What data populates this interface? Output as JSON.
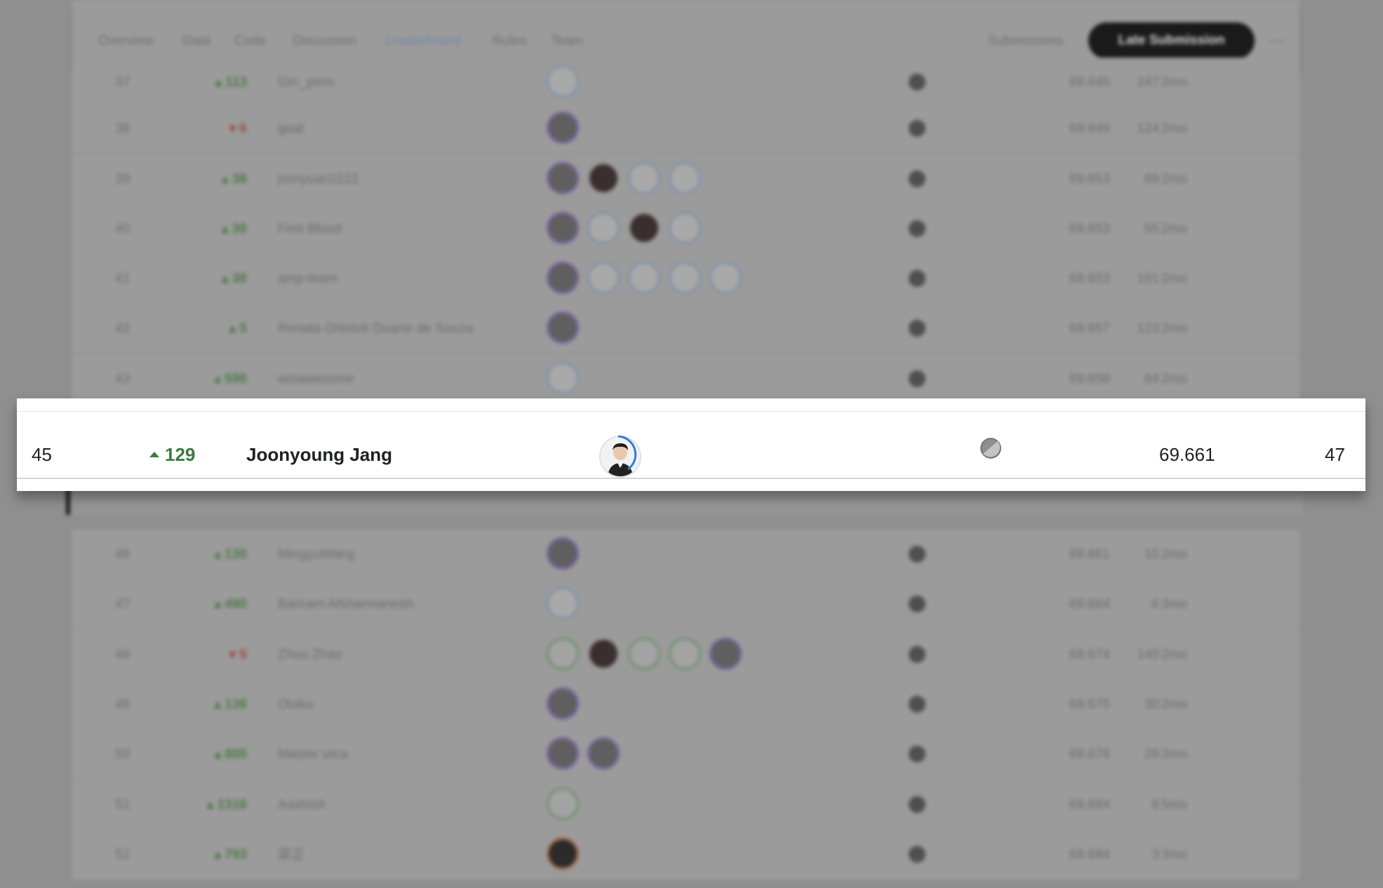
{
  "tabs": [
    {
      "label": "Overview",
      "active": false
    },
    {
      "label": "Data",
      "active": false
    },
    {
      "label": "Code",
      "active": false
    },
    {
      "label": "Discussion",
      "active": false
    },
    {
      "label": "Leaderboard",
      "active": true
    },
    {
      "label": "Rules",
      "active": false
    },
    {
      "label": "Team",
      "active": false
    }
  ],
  "submissions_label": "Submissions",
  "late_submission_label": "Late Submission",
  "more_label": "···",
  "rows": [
    {
      "rank": "37",
      "delta": "113",
      "dir": "up",
      "team": "Gin_yiem",
      "members": [
        "light"
      ],
      "score": "69.645",
      "entries": "247",
      "last": "2mo"
    },
    {
      "rank": "38",
      "delta": "6",
      "dir": "down",
      "team": "goat",
      "members": [
        "purple"
      ],
      "score": "69.649",
      "entries": "124",
      "last": "2mo"
    },
    {
      "rank": "39",
      "delta": "38",
      "dir": "up",
      "team": "jixinyuan1122",
      "members": [
        "purple",
        "dark",
        "light",
        "light"
      ],
      "score": "69.653",
      "entries": "89",
      "last": "2mo"
    },
    {
      "rank": "40",
      "delta": "38",
      "dir": "up",
      "team": "First Blood",
      "members": [
        "purple",
        "light",
        "dark",
        "light"
      ],
      "score": "69.653",
      "entries": "55",
      "last": "2mo"
    },
    {
      "rank": "41",
      "delta": "38",
      "dir": "up",
      "team": "amp-team",
      "members": [
        "purple",
        "light",
        "light",
        "light",
        "light"
      ],
      "score": "69.653",
      "entries": "101",
      "last": "2mo"
    },
    {
      "rank": "42",
      "delta": "5",
      "dir": "up",
      "team": "Renata Ghisloti Duarte de Souza",
      "members": [
        "purple"
      ],
      "score": "69.657",
      "entries": "123",
      "last": "2mo"
    },
    {
      "rank": "43",
      "delta": "590",
      "dir": "up",
      "team": "wisawesome",
      "members": [
        "light"
      ],
      "score": "69.658",
      "entries": "64",
      "last": "2mo"
    },
    {
      "rank": "46",
      "delta": "130",
      "dir": "up",
      "team": "MingyuWang",
      "members": [
        "purple"
      ],
      "score": "69.661",
      "entries": "15",
      "last": "2mo"
    },
    {
      "rank": "47",
      "delta": "490",
      "dir": "up",
      "team": "Bahram Afsharmanesh",
      "members": [
        "light"
      ],
      "score": "69.664",
      "entries": "6",
      "last": "3mo"
    },
    {
      "rank": "48",
      "delta": "5",
      "dir": "down",
      "team": "Zhuo Zhao",
      "members": [
        "green",
        "dark",
        "green",
        "green",
        "purple"
      ],
      "score": "69.674",
      "entries": "140",
      "last": "2mo"
    },
    {
      "rank": "49",
      "delta": "136",
      "dir": "up",
      "team": "Otaku",
      "members": [
        "purple"
      ],
      "score": "69.675",
      "entries": "30",
      "last": "2mo"
    },
    {
      "rank": "50",
      "delta": "805",
      "dir": "up",
      "team": "Master utca",
      "members": [
        "purple",
        "purple"
      ],
      "score": "69.678",
      "entries": "28",
      "last": "3mo"
    },
    {
      "rank": "51",
      "delta": "1316",
      "dir": "up",
      "team": "Aashish",
      "members": [
        "green"
      ],
      "score": "69.684",
      "entries": "8",
      "last": "5mo"
    },
    {
      "rank": "52",
      "delta": "793",
      "dir": "up",
      "team": "梁正",
      "members": [
        "orange"
      ],
      "score": "69.684",
      "entries": "3",
      "last": "3mo"
    }
  ],
  "highlight": {
    "rank": "45",
    "delta": "129",
    "team": "Joonyoung Jang",
    "score": "69.661",
    "entries": "47"
  }
}
